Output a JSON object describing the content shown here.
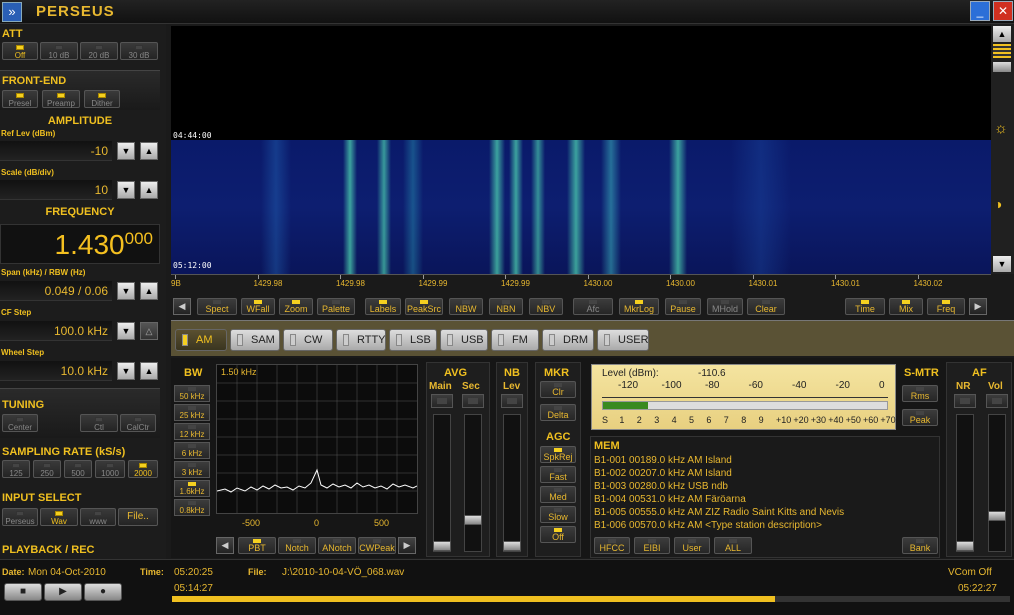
{
  "app": {
    "title": "PERSEUS",
    "icon_letter": "»",
    "min_glyph": "_",
    "close_glyph": "✕",
    "colors": {
      "accent": "#f0c020",
      "close": "#d03020"
    }
  },
  "att": {
    "title": "ATT",
    "buttons": [
      "Off",
      "10 dB",
      "20 dB",
      "30 dB"
    ]
  },
  "frontend": {
    "title": "FRONT-END",
    "buttons": [
      "Presel",
      "Preamp",
      "Dither"
    ]
  },
  "amplitude": {
    "title": "AMPLITUDE",
    "ref_label": "Ref Lev (dBm)",
    "ref_value": "-10",
    "scale_label": "Scale (dB/div)",
    "scale_value": "10"
  },
  "frequency": {
    "title": "FREQUENCY",
    "main": "1.430",
    "sub": "000",
    "span_label": "Span (kHz) / RBW (Hz)",
    "span_value": "0.049 / 0.06",
    "cf_label": "CF Step",
    "cf_value": "100.0 kHz",
    "wheel_label": "Wheel Step",
    "wheel_value": "10.0 kHz"
  },
  "tuning": {
    "title": "TUNING",
    "buttons": [
      "Center",
      "Ctl",
      "CalCtr"
    ]
  },
  "sampling": {
    "title": "SAMPLING RATE (kS/s)",
    "buttons": [
      "125",
      "250",
      "500",
      "1000",
      "2000"
    ]
  },
  "input": {
    "title": "INPUT SELECT",
    "buttons": [
      "Perseus",
      "Wav",
      "www",
      "File.."
    ]
  },
  "playback": {
    "title": "PLAYBACK / REC"
  },
  "waterfall": {
    "clock_first": "04:44:00",
    "clock_last": "05:12:00",
    "ticks": [
      "9B",
      "1429.98",
      "1429.98",
      "1429.99",
      "1429.99",
      "1430.00",
      "1430.00",
      "1430.01",
      "1430.01",
      "1430.02"
    ]
  },
  "toolbar": {
    "buttons": [
      "Spect",
      "WFall",
      "Zoom",
      "Palette",
      "Labels",
      "PeakSrc",
      "NBW",
      "NBN",
      "NBV",
      "Afc",
      "MkrLog",
      "Pause",
      "MHold",
      "Clear",
      "Time",
      "Mix",
      "Freq"
    ],
    "left_arrow": "◀",
    "right_arrow": "▶"
  },
  "modes": [
    "AM",
    "SAM",
    "CW",
    "RTTY",
    "LSB",
    "USB",
    "FM",
    "DRM",
    "USER"
  ],
  "bw": {
    "title": "BW",
    "current": "1.50 kHz",
    "buttons": [
      "50 kHz",
      "25 kHz",
      "12 kHz",
      "6 kHz",
      "3 kHz",
      "1.6kHz",
      "0.8kHz"
    ],
    "x_ticks": [
      "-500",
      "0",
      "500"
    ],
    "bottom": [
      "PBT",
      "Notch",
      "ANotch",
      "CWPeak"
    ]
  },
  "avg": {
    "title": "AVG",
    "main": "Main",
    "sec": "Sec"
  },
  "nb": {
    "title": "NB",
    "lev": "Lev"
  },
  "mkr": {
    "title": "MKR",
    "clr": "Clr",
    "delta": "Delta"
  },
  "agc": {
    "title": "AGC",
    "buttons": [
      "SpkRej",
      "Fast",
      "Med",
      "Slow",
      "Off"
    ]
  },
  "level": {
    "label": "Level (dBm):",
    "value": "-110.6",
    "top_ticks": [
      "-120",
      "-100",
      "-80",
      "-60",
      "-40",
      "-20",
      "0"
    ],
    "bottom_ticks": [
      "S",
      "1",
      "2",
      "3",
      "4",
      "5",
      "6",
      "7",
      "8",
      "9",
      "+10",
      "+20",
      "+30",
      "+40",
      "+50",
      "+60",
      "+70"
    ],
    "bar_fraction": 0.16
  },
  "smtr": {
    "title": "S-MTR",
    "rms": "Rms",
    "peak": "Peak"
  },
  "af": {
    "title": "AF",
    "nr": "NR",
    "vol": "Vol"
  },
  "mem": {
    "title": "MEM",
    "rows": [
      "B1-001 00189.0 kHz  AM  Island",
      "B1-002 00207.0 kHz  AM  Island",
      "B1-003 00280.0 kHz USB  ndb",
      "B1-004 00531.0 kHz  AM  Färöarna",
      "B1-005 00555.0 kHz  AM  ZIZ Radio Saint Kitts and Nevis",
      "B1-006 00570.0 kHz  AM  <Type station description>"
    ],
    "buttons": [
      "HFCC",
      "EIBI",
      "User",
      "ALL",
      "Bank"
    ]
  },
  "status": {
    "date_label": "Date:",
    "date_value": "Mon 04-Oct-2010",
    "time_label": "Time:",
    "time_value": "05:20:25",
    "file_label": "File:",
    "file_value": "J:\\2010-10-04-VÖ_068.wav",
    "vcom": "VCom Off",
    "pos_start": "05:14:27",
    "pos_end": "05:22:27",
    "progress": 0.72
  },
  "playback_buttons": [
    "■",
    "▶",
    "●"
  ]
}
